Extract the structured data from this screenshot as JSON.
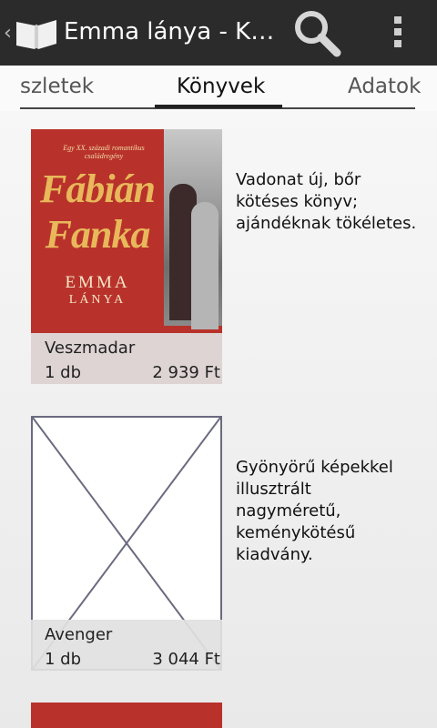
{
  "actionbar": {
    "title": "Emma lánya - K…"
  },
  "tabs": {
    "left": "szletek",
    "center": "Könyvek",
    "right": "Adatok"
  },
  "listings": [
    {
      "seller": "Veszmadar",
      "quantity": "1 db",
      "price": "2 939 Ft",
      "description": "Vadonat új, bőr kötéses könyv; ajándéknak tökéletes.",
      "cover": {
        "tagline": "Egy XX. századi romantikus családregény",
        "author_line1": "Fábián",
        "author_line2": "Fanka",
        "title_line1": "EMMA",
        "title_line2": "LÁNYA"
      }
    },
    {
      "seller": "Avenger",
      "quantity": "1 db",
      "price": "3 044 Ft",
      "description": "Gyönyörű képekkel illusztrált nagyméretű, keménykötésű kiadvány."
    }
  ]
}
